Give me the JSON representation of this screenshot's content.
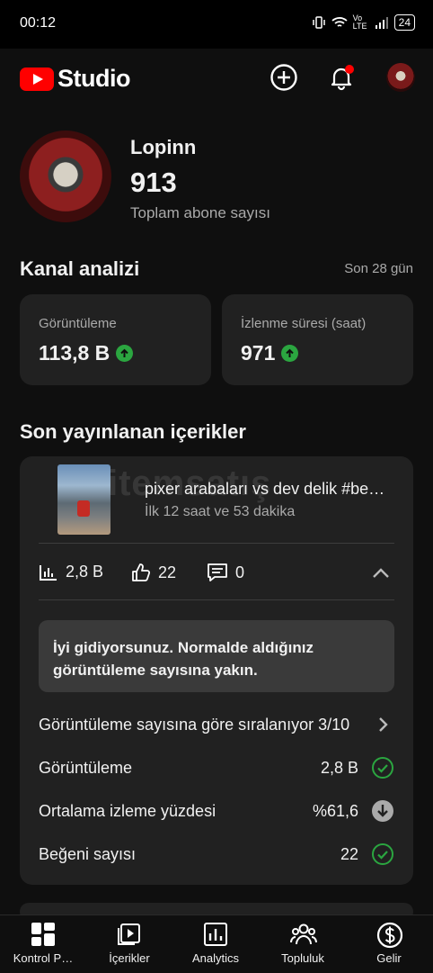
{
  "status": {
    "time": "00:12",
    "volte": "Vo LTE",
    "battery": "24"
  },
  "header": {
    "logo_text": "Studio",
    "icons": [
      "create-icon",
      "notification-bell-icon",
      "account-avatar"
    ],
    "accent": "#ff0000"
  },
  "profile": {
    "name": "Lopinn",
    "subscribers": "913",
    "subscribers_label": "Toplam abone sayısı"
  },
  "analytics": {
    "title": "Kanal analizi",
    "period": "Son 28 gün",
    "metrics": [
      {
        "label": "Görüntüleme",
        "value": "113,8 B",
        "trend": "up"
      },
      {
        "label": "İzlenme süresi (saat)",
        "value": "971",
        "trend": "up"
      }
    ]
  },
  "latest": {
    "title": "Son yayınlanan içerikler",
    "video": {
      "title": "pixer arabaları vs dev delik #be…",
      "subtitle": "İlk 12 saat ve 53 dakika",
      "views": "2,8 B",
      "likes": "22",
      "comments": "0"
    },
    "tip": "İyi gidiyorsunuz. Normalde aldığınız görüntüleme sayısına yakın.",
    "ranking": "Görüntüleme sayısına göre sıralanıyor 3/10",
    "rows": [
      {
        "label": "Görüntüleme",
        "value": "2,8 B",
        "status": "check"
      },
      {
        "label": "Ortalama izleme yüzdesi",
        "value": "%61,6",
        "status": "down"
      },
      {
        "label": "Beğeni sayısı",
        "value": "22",
        "status": "check"
      }
    ]
  },
  "watermark": "itemsatış",
  "nav": [
    {
      "label": "Kontrol P…",
      "icon": "dashboard-icon"
    },
    {
      "label": "İçerikler",
      "icon": "content-icon"
    },
    {
      "label": "Analytics",
      "icon": "analytics-icon"
    },
    {
      "label": "Topluluk",
      "icon": "community-icon"
    },
    {
      "label": "Gelir",
      "icon": "earn-icon"
    }
  ]
}
